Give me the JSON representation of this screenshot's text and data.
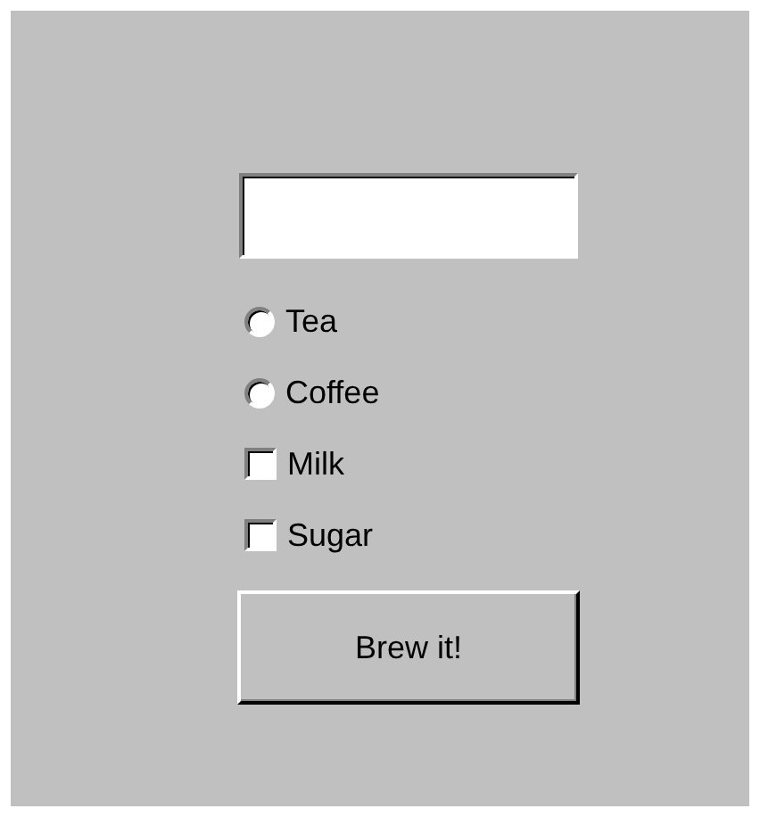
{
  "form": {
    "options": [
      {
        "kind": "radio",
        "label": "Tea",
        "selected": false
      },
      {
        "kind": "radio",
        "label": "Coffee",
        "selected": false
      },
      {
        "kind": "checkbox",
        "label": "Milk",
        "checked": false
      },
      {
        "kind": "checkbox",
        "label": "Sugar",
        "checked": false
      }
    ],
    "button": "Brew it!"
  }
}
